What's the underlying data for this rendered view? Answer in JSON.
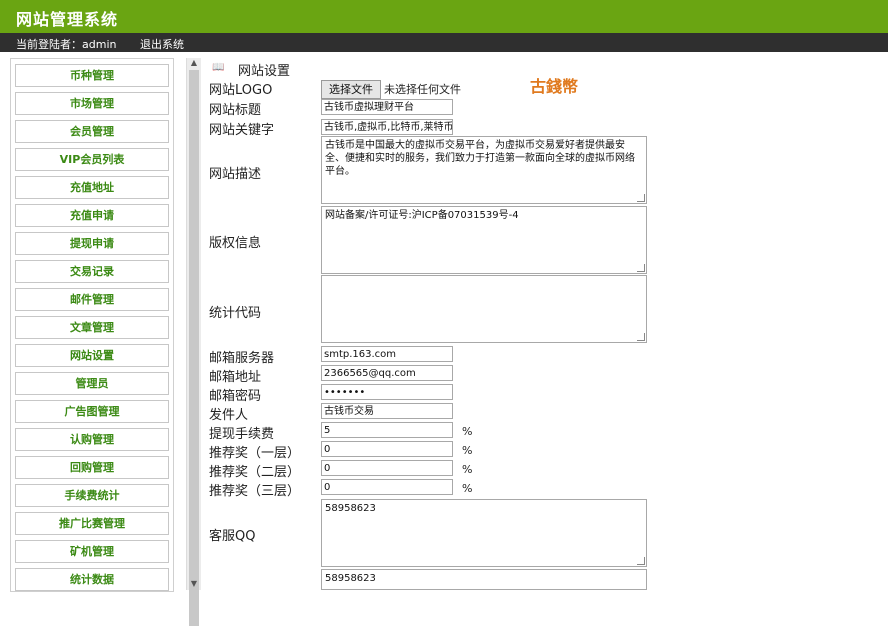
{
  "header": {
    "title": "网站管理系统"
  },
  "userbar": {
    "current_user": "当前登陆者：admin",
    "logout": "退出系统"
  },
  "sidebar": {
    "items": [
      {
        "label": "币种管理"
      },
      {
        "label": "市场管理"
      },
      {
        "label": "会员管理"
      },
      {
        "label": "VIP会员列表"
      },
      {
        "label": "充值地址"
      },
      {
        "label": "充值申请"
      },
      {
        "label": "提现申请"
      },
      {
        "label": "交易记录"
      },
      {
        "label": "邮件管理"
      },
      {
        "label": "文章管理"
      },
      {
        "label": "网站设置"
      },
      {
        "label": "管理员"
      },
      {
        "label": "广告图管理"
      },
      {
        "label": "认购管理"
      },
      {
        "label": "回购管理"
      },
      {
        "label": "手续费统计"
      },
      {
        "label": "推广比赛管理"
      },
      {
        "label": "矿机管理"
      },
      {
        "label": "统计数据"
      }
    ]
  },
  "main": {
    "section_title": "网站设置",
    "logo": {
      "label": "网站LOGO",
      "button": "选择文件",
      "status": "未选择任何文件",
      "preview_text": "古錢幣"
    },
    "site_title": {
      "label": "网站标题",
      "value": "古钱币虚拟理财平台"
    },
    "keywords": {
      "label": "网站关键字",
      "value": "古钱币,虚拟币,比特币,莱特币"
    },
    "description": {
      "label": "网站描述",
      "value": "古钱币是中国最大的虚拟币交易平台，为虚拟币交易爱好者提供最安全、便捷和实时的服务，我们致力于打造第一款面向全球的虚拟币网络平台。"
    },
    "copyright": {
      "label": "版权信息",
      "value": "网站备案/许可证号:沪ICP备07031539号-4"
    },
    "stats_code": {
      "label": "统计代码",
      "value": ""
    },
    "mail_server": {
      "label": "邮箱服务器",
      "value": "smtp.163.com"
    },
    "mail_address": {
      "label": "邮箱地址",
      "value": "2366565@qq.com"
    },
    "mail_password": {
      "label": "邮箱密码",
      "value": "•••••••"
    },
    "sender": {
      "label": "发件人",
      "value": "古钱币交易"
    },
    "withdraw_fee": {
      "label": "提现手续费",
      "value": "5",
      "unit": "%"
    },
    "referral_1": {
      "label": "推荐奖（一层）",
      "value": "0",
      "unit": "%"
    },
    "referral_2": {
      "label": "推荐奖（二层）",
      "value": "0",
      "unit": "%"
    },
    "referral_3": {
      "label": "推荐奖（三层）",
      "value": "0",
      "unit": "%"
    },
    "service_qq": {
      "label": "客服QQ",
      "value": "58958623"
    },
    "next_field": {
      "value": "58958623"
    }
  }
}
